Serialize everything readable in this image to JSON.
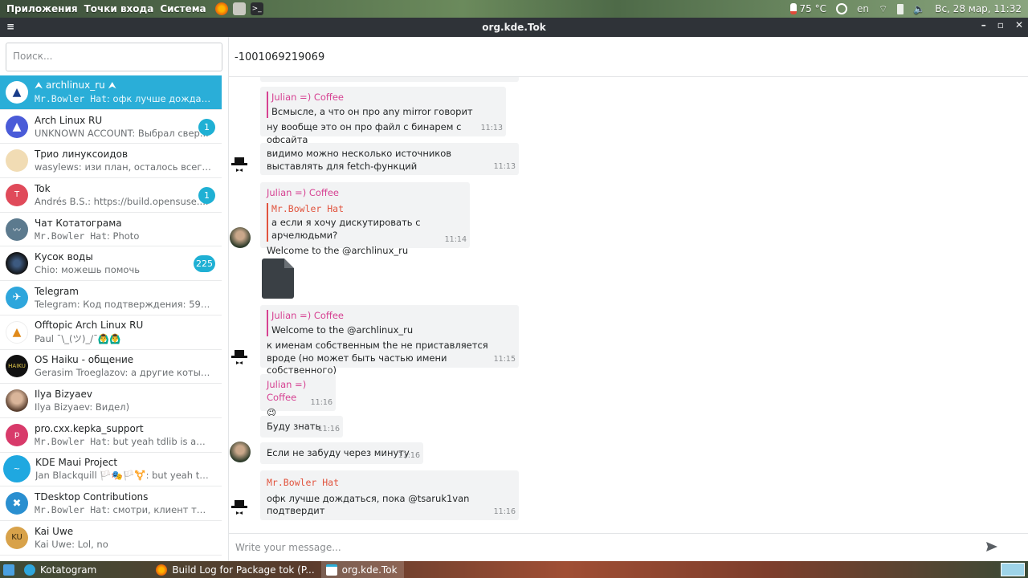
{
  "top_panel": {
    "menus": [
      "Приложения",
      "Точки входа",
      "Система"
    ],
    "temperature": "75 °C",
    "layout": "en",
    "datetime": "Вс, 28 мар, 11:32"
  },
  "window": {
    "title": "org.kde.Tok"
  },
  "sidebar": {
    "search_placeholder": "Поиск...",
    "chats": [
      {
        "name": "⮝ archlinux_ru ⮝",
        "sender": "Mr.Bowler Hat",
        "text": ": офк лучше дождатьс...",
        "badge": "",
        "avatar_color": "#ffffff",
        "avatar_text": "▲",
        "mono": true
      },
      {
        "name": "Arch Linux RU",
        "sender": "",
        "text": "UNKNOWN ACCOUNT: Выбрал свер...",
        "badge": "1",
        "avatar_color": "#4a5bd8",
        "avatar_text": "▲",
        "mono": false
      },
      {
        "name": "Трио линуксоидов",
        "sender": "",
        "text": "wasylews: изи план, осталось всего н...",
        "badge": "",
        "avatar_color": "#c97f3c",
        "avatar_text": "",
        "mono": false
      },
      {
        "name": "Tok",
        "sender": "",
        "text": "Andrés B.S.: https://build.opensuse....",
        "badge": "1",
        "avatar_color": "#e04a5a",
        "avatar_text": "T",
        "mono": false
      },
      {
        "name": "Чат Котатограма",
        "sender": "Mr.Bowler Hat",
        "text": ": Photo",
        "badge": "",
        "avatar_color": "#5c7a8e",
        "avatar_text": "",
        "mono": true
      },
      {
        "name": "Кусок воды",
        "sender": "",
        "text": "Chio: можешь помочь",
        "badge": "225",
        "avatar_color": "#1b1d22",
        "avatar_text": "",
        "mono": false
      },
      {
        "name": "Telegram",
        "sender": "",
        "text": "Telegram: Код подтверждения: 59065. ...",
        "badge": "",
        "avatar_color": "#2ea6dc",
        "avatar_text": "✈",
        "mono": false
      },
      {
        "name": "Offtopic Arch Linux RU",
        "sender": "",
        "text": "Paul ¯\\_(ツ)_/¯🙆‍♂️🙆‍♂️",
        "badge": "",
        "avatar_color": "#ffffff",
        "avatar_text": "▲",
        "mono": false
      },
      {
        "name": "OS Haiku - общение",
        "sender": "",
        "text": "Gerasim Troeglazov: а другие коты быв...",
        "badge": "",
        "avatar_color": "#111111",
        "avatar_text": "HAIKU",
        "mono": false
      },
      {
        "name": "Ilya Bizyaev",
        "sender": "",
        "text": "Ilya Bizyaev: Видел)",
        "badge": "",
        "avatar_color": "#6a4e3f",
        "avatar_text": "",
        "mono": false
      },
      {
        "name": "pro.cxx.kepka_support",
        "sender": "Mr.Bowler Hat",
        "text": ": but yeah tdlib is awes...",
        "badge": "",
        "avatar_color": "#d83a6a",
        "avatar_text": "p",
        "mono": true
      },
      {
        "name": "KDE Maui Project",
        "sender": "",
        "text": "Jan Blackquill 🏳️🎭🏳️⚧️: but yeah tdlib ...",
        "badge": "",
        "avatar_color": "#1fa8e0",
        "avatar_text": "",
        "mono": false
      },
      {
        "name": "TDesktop Contributions",
        "sender": "Mr.Bowler Hat",
        "text": ": смотри, клиент телег...",
        "badge": "",
        "avatar_color": "#2a8fd0",
        "avatar_text": "✖",
        "mono": true
      },
      {
        "name": "Kai Uwe",
        "sender": "",
        "text": "Kai Uwe: Lol, no",
        "badge": "",
        "avatar_color": "#d8a24a",
        "avatar_text": "KU",
        "mono": false
      }
    ]
  },
  "chat": {
    "title": "-1001069219069",
    "messages": [
      {
        "author": "Julian =) Coffee",
        "quote_author": "",
        "quote": "Всмысле, а что он про any mirror говорит",
        "text": "ну вообще это он про файл с бинарем с офсайта",
        "time": "11:13"
      },
      {
        "author": "",
        "quote_author": "",
        "quote": "",
        "text": "видимо можно несколько источников выставлять для fetch-функций",
        "time": "11:13"
      },
      {
        "author": "Julian =) Coffee",
        "quote_author": "Mr.Bowler Hat",
        "quote": "а если я хочу дискутировать с арчелюдьми?",
        "text": "Welcome to the @archlinux_ru",
        "time": "11:14"
      },
      {
        "author": "Julian =) Coffee",
        "quote_author": "",
        "quote": "Welcome to the @archlinux_ru",
        "text": "к именам собственным the не приставляется вроде (но может быть частью имени собственного)",
        "time": "11:15"
      },
      {
        "author": "Julian =) Coffee",
        "quote_author": "",
        "quote": "",
        "text": "😉",
        "time": "11:16"
      },
      {
        "author": "",
        "quote_author": "",
        "quote": "",
        "text": "Буду знать",
        "time": "11:16"
      },
      {
        "author": "",
        "quote_author": "",
        "quote": "",
        "text": "Если не забуду через минуту",
        "time": "11:16"
      },
      {
        "author": "Mr.Bowler Hat",
        "quote_author": "",
        "quote": "",
        "text": "офк лучше дождаться, пока @tsaruk1van подтвердит",
        "time": "11:16"
      }
    ],
    "composer_placeholder": "Write your message..."
  },
  "taskbar": {
    "tasks": [
      "Kotatogram",
      "Build Log for Package tok (P...",
      "org.kde.Tok"
    ]
  }
}
